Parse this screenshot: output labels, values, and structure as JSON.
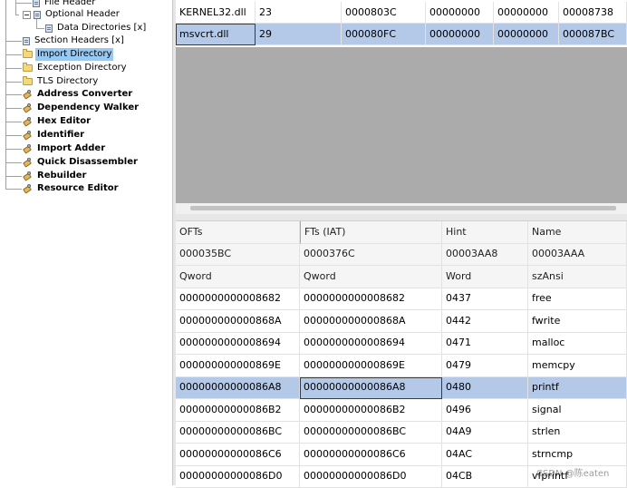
{
  "tree": {
    "items": [
      {
        "label": "File Header",
        "icon": "document-icon",
        "kind": "doc"
      },
      {
        "label": "Optional Header",
        "icon": "document-icon",
        "kind": "doc",
        "expander": true
      },
      {
        "label": "Data Directories [x]",
        "icon": "document-icon",
        "kind": "doc"
      },
      {
        "label": "Section Headers [x]",
        "icon": "document-icon",
        "kind": "doc"
      },
      {
        "label": "Import Directory",
        "icon": "folder-icon",
        "kind": "folder",
        "selected": true
      },
      {
        "label": "Exception Directory",
        "icon": "folder-icon",
        "kind": "folder"
      },
      {
        "label": "TLS Directory",
        "icon": "folder-icon",
        "kind": "folder"
      },
      {
        "label": "Address Converter",
        "icon": "tool-icon",
        "kind": "tool"
      },
      {
        "label": "Dependency Walker",
        "icon": "tool-icon",
        "kind": "tool"
      },
      {
        "label": "Hex Editor",
        "icon": "tool-icon",
        "kind": "tool"
      },
      {
        "label": "Identifier",
        "icon": "tool-icon",
        "kind": "tool"
      },
      {
        "label": "Import Adder",
        "icon": "tool-icon",
        "kind": "tool"
      },
      {
        "label": "Quick Disassembler",
        "icon": "tool-icon",
        "kind": "tool"
      },
      {
        "label": "Rebuilder",
        "icon": "tool-icon",
        "kind": "tool"
      },
      {
        "label": "Resource Editor",
        "icon": "tool-icon",
        "kind": "tool"
      }
    ]
  },
  "modules": {
    "rows": [
      [
        "KERNEL32.dll",
        "23",
        "0000803C",
        "00000000",
        "00000000",
        "00008738"
      ],
      [
        "msvcrt.dll",
        "29",
        "000080FC",
        "00000000",
        "00000000",
        "000087BC"
      ]
    ],
    "selected_row": 1
  },
  "imports": {
    "headers": [
      "OFTs",
      "FTs (IAT)",
      "Hint",
      "Name"
    ],
    "header_values": [
      "000035BC",
      "0000376C",
      "00003AA8",
      "00003AAA"
    ],
    "types": [
      "Qword",
      "Qword",
      "Word",
      "szAnsi"
    ],
    "rows": [
      [
        "0000000000008682",
        "0000000000008682",
        "0437",
        "free"
      ],
      [
        "000000000000868A",
        "000000000000868A",
        "0442",
        "fwrite"
      ],
      [
        "0000000000008694",
        "0000000000008694",
        "0471",
        "malloc"
      ],
      [
        "000000000000869E",
        "000000000000869E",
        "0479",
        "memcpy"
      ],
      [
        "00000000000086A8",
        "00000000000086A8",
        "0480",
        "printf"
      ],
      [
        "00000000000086B2",
        "00000000000086B2",
        "0496",
        "signal"
      ],
      [
        "00000000000086BC",
        "00000000000086BC",
        "04A9",
        "strlen"
      ],
      [
        "00000000000086C6",
        "00000000000086C6",
        "04AC",
        "strncmp"
      ],
      [
        "00000000000086D0",
        "00000000000086D0",
        "04CB",
        "vfprintf"
      ]
    ],
    "selected_row": 4
  },
  "watermark": "CSDN @陈eaten",
  "colors": {
    "selection": "#b4c8e8",
    "tree_selection": "#99c8f0",
    "empty_area": "#ababab"
  }
}
